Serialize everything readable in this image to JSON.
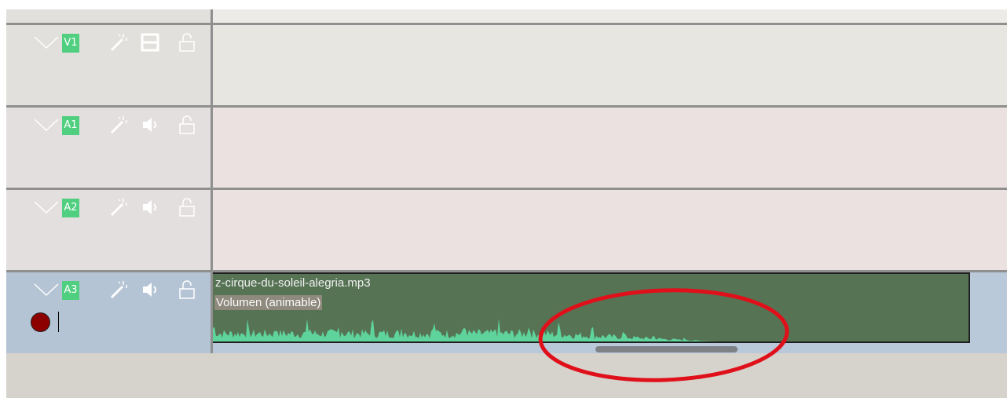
{
  "tracks": [
    {
      "name": "V1",
      "type": "video"
    },
    {
      "name": "A1",
      "type": "audio"
    },
    {
      "name": "A2",
      "type": "audio"
    },
    {
      "name": "A3",
      "type": "audio"
    }
  ],
  "clip": {
    "filename": "z-cirque-du-soleil-alegria.mp3",
    "effect_label": "Volumen (animable)"
  },
  "icons": {
    "collapse": "chevron-down-icon",
    "effects": "magic-wand-icon",
    "video_toggle": "film-icon",
    "audio_toggle": "speaker-icon",
    "lock": "lock-icon",
    "record": "record-icon"
  },
  "colors": {
    "track_label": "#4fcf7f",
    "clip_background": "#567354",
    "waveform": "#5fd39c",
    "record": "#8d0000",
    "annotation": "#e0101a",
    "selected_track": "#b4c4d4"
  }
}
